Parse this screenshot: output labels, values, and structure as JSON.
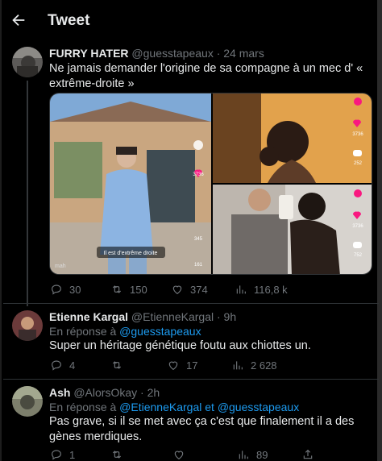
{
  "header": {
    "title": "Tweet"
  },
  "main_tweet": {
    "author_name": "FURRY HATER",
    "handle_date": "@guesstapeaux · 24 mars",
    "text": "Ne jamais demander l'origine de sa compagne à un mec d' « extrême-droite »",
    "media": {
      "left_caption": "Il est d'extrême droite",
      "watermark": "mah",
      "like_count_1": "3736",
      "comment_count_1": "252",
      "like_count_2": "3736",
      "comment_count_2": "752",
      "like_count_3": "3736",
      "comment_count_3": "345",
      "share_count": "161"
    },
    "stats": {
      "replies": "30",
      "retweets": "150",
      "likes": "374",
      "views": "116,8 k"
    }
  },
  "replies": [
    {
      "author_name": "Etienne Kargal",
      "handle_date": "@EtienneKargal · 9h",
      "reply_prefix": "En réponse à ",
      "reply_to_1": "@guesstapeaux",
      "text": "Super un héritage génétique foutu aux chiottes un.",
      "stats": {
        "replies": "4",
        "retweets": "",
        "likes": "17",
        "views": "2 628"
      }
    },
    {
      "author_name": "Ash",
      "handle_date": "@AlorsOkay · 2h",
      "reply_prefix": "En réponse à ",
      "reply_to_1": "@EtienneKargal",
      "reply_join": " et ",
      "reply_to_2": "@guesstapeaux",
      "text": "Pas grave, si il se met avec ça c'est que finalement il a des gènes merdiques.",
      "stats": {
        "replies": "1",
        "retweets": "",
        "likes": "",
        "views": "89"
      }
    }
  ],
  "colors": {
    "accent": "#1d9bf0",
    "background": "#000000",
    "muted": "#71767b",
    "like_red": "#f91880"
  }
}
